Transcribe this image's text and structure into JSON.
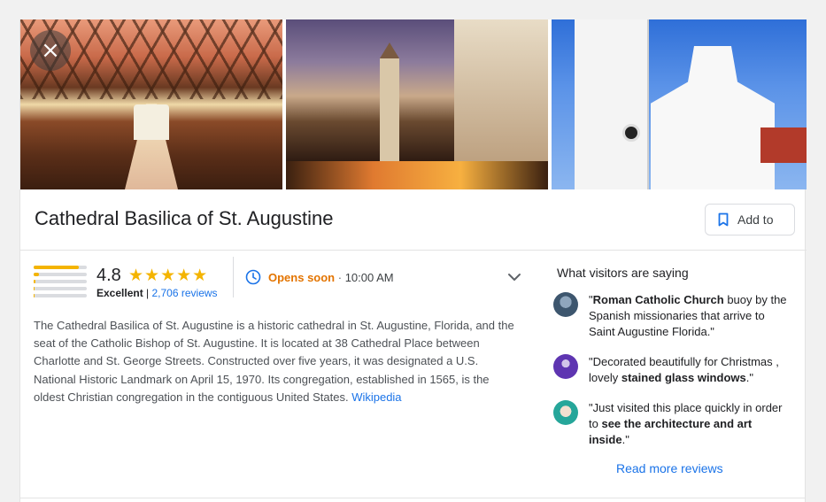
{
  "place": {
    "title": "Cathedral Basilica of St. Augustine",
    "add_button_label": "Add to"
  },
  "photos": {
    "close_glyph": "×",
    "items": [
      "cathedral-interior-photo",
      "street-at-dusk-photo",
      "cathedral-facade-photo"
    ]
  },
  "rating": {
    "value": "4.8",
    "stars": "★★★★★",
    "label": "Excellent",
    "separator": " | ",
    "reviews_link": "2,706 reviews",
    "distribution": [
      0.85,
      0.1,
      0.03,
      0.01,
      0.01
    ]
  },
  "hours": {
    "status": "Opens soon",
    "separator": " · ",
    "time": "10:00 AM"
  },
  "description": {
    "text": "The Cathedral Basilica of St. Augustine is a historic cathedral in St. Augustine, Florida, and the seat of the Catholic Bishop of St. Augustine. It is located at 38 Cathedral Place between Charlotte and St. George Streets. Constructed over five years, it was designated a U.S. National Historic Landmark on April 15, 1970. Its congregation, established in 1565, is the oldest Christian congregation in the contiguous United States.",
    "source_link": "Wikipedia"
  },
  "visitors": {
    "heading": "What visitors are saying",
    "reviews": [
      {
        "open": "\"",
        "bold": "Roman Catholic Church",
        "rest": " buoy by the Spanish missionaries that arrive to Saint Augustine Florida.\"",
        "avatar_color": "#4a6a8a"
      },
      {
        "pre": "\"Decorated beautifully for Christmas , lovely ",
        "bold": "stained glass windows",
        "post": ".\"",
        "avatar_color": "#5e35b1"
      },
      {
        "pre": "\"Just visited this place quickly in order to ",
        "bold": "see the architecture and art inside",
        "post": ".\"",
        "avatar_color": "#26a69a"
      }
    ],
    "more_link": "Read more reviews"
  }
}
